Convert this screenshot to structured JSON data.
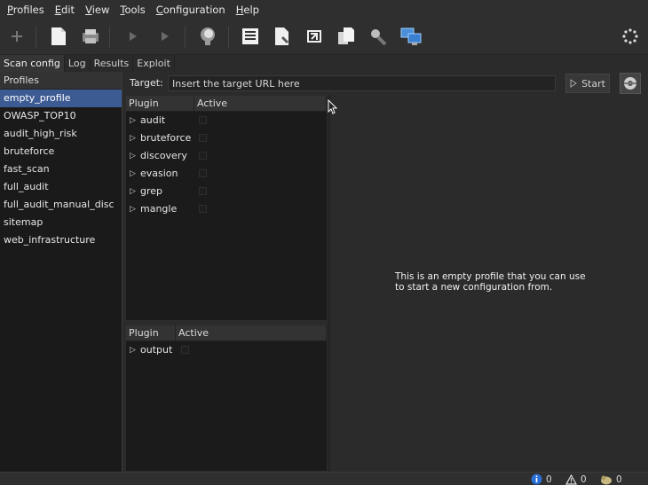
{
  "menu": [
    {
      "label": "Profiles",
      "mnemonic": "P"
    },
    {
      "label": "Edit",
      "mnemonic": "E"
    },
    {
      "label": "View",
      "mnemonic": "V"
    },
    {
      "label": "Tools",
      "mnemonic": "T"
    },
    {
      "label": "Configuration",
      "mnemonic": "C"
    },
    {
      "label": "Help",
      "mnemonic": "H"
    }
  ],
  "tabs": [
    {
      "label": "Scan config",
      "active": true
    },
    {
      "label": "Log",
      "active": false
    },
    {
      "label": "Results",
      "active": false
    },
    {
      "label": "Exploit",
      "active": false
    }
  ],
  "profiles": {
    "header": "Profiles",
    "items": [
      "empty_profile",
      "OWASP_TOP10",
      "audit_high_risk",
      "bruteforce",
      "fast_scan",
      "full_audit",
      "full_audit_manual_disc",
      "sitemap",
      "web_infrastructure"
    ],
    "selected": "empty_profile"
  },
  "target": {
    "label": "Target:",
    "value": "Insert the target URL here",
    "start_label": "Start"
  },
  "plugins_top": {
    "col_plugin": "Plugin",
    "col_active": "Active",
    "rows": [
      "audit",
      "bruteforce",
      "discovery",
      "evasion",
      "grep",
      "mangle"
    ]
  },
  "plugins_bottom": {
    "col_plugin": "Plugin",
    "col_active": "Active",
    "rows": [
      "output"
    ]
  },
  "description": "This is an empty profile that you can use\nto start a new configuration from.",
  "status": {
    "info_count": "0",
    "warning_count": "0",
    "vuln_count": "0"
  },
  "colors": {
    "selection": "#3d5b93",
    "background": "#2b2b2b",
    "info_blue": "#2a6fd6"
  }
}
